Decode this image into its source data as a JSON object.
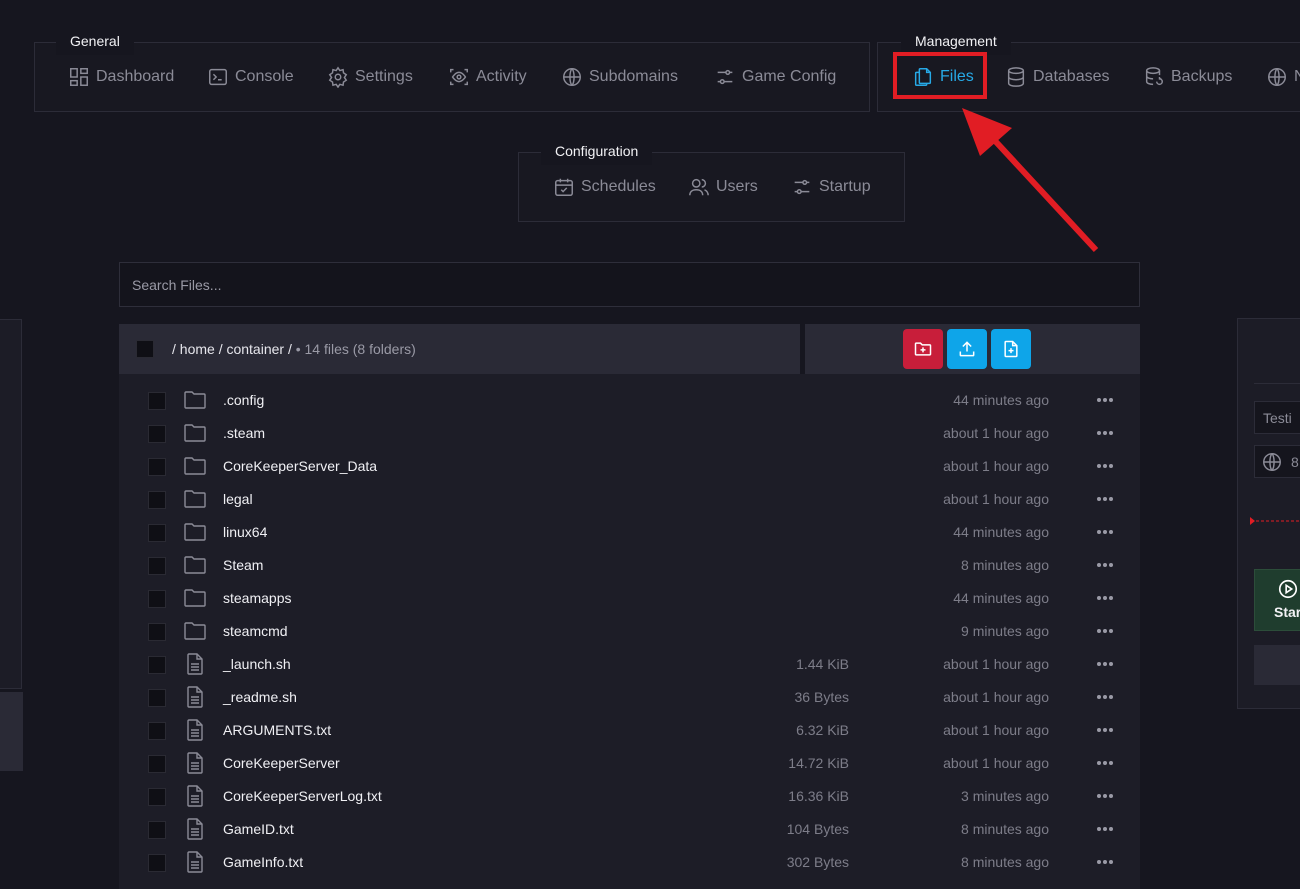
{
  "nav": {
    "general": {
      "label": "General",
      "items": [
        {
          "label": "Dashboard",
          "icon": "dashboard-icon"
        },
        {
          "label": "Console",
          "icon": "console-icon"
        },
        {
          "label": "Settings",
          "icon": "gear-icon"
        },
        {
          "label": "Activity",
          "icon": "eye-icon"
        },
        {
          "label": "Subdomains",
          "icon": "globe-icon"
        },
        {
          "label": "Game Config",
          "icon": "sliders-icon"
        }
      ]
    },
    "management": {
      "label": "Management",
      "items": [
        {
          "label": "Files",
          "icon": "files-icon",
          "active": true
        },
        {
          "label": "Databases",
          "icon": "database-icon"
        },
        {
          "label": "Backups",
          "icon": "backup-icon"
        },
        {
          "label": "N",
          "icon": "globe-icon"
        }
      ]
    },
    "configuration": {
      "label": "Configuration",
      "items": [
        {
          "label": "Schedules",
          "icon": "calendar-icon"
        },
        {
          "label": "Users",
          "icon": "users-icon"
        },
        {
          "label": "Startup",
          "icon": "sliders-icon"
        }
      ]
    }
  },
  "search": {
    "placeholder": "Search Files..."
  },
  "breadcrumb": {
    "path": "/ home / container /",
    "summary": "• 14 files (8 folders)"
  },
  "actions": [
    {
      "name": "new-folder-button",
      "icon": "folder-plus-icon",
      "color": "#c81e3a"
    },
    {
      "name": "upload-button",
      "icon": "upload-icon",
      "color": "#0ea5e9"
    },
    {
      "name": "new-file-button",
      "icon": "file-plus-icon",
      "color": "#0ea5e9"
    }
  ],
  "files": [
    {
      "name": ".config",
      "type": "folder",
      "size": "",
      "modified": "44 minutes ago"
    },
    {
      "name": ".steam",
      "type": "folder",
      "size": "",
      "modified": "about 1 hour ago"
    },
    {
      "name": "CoreKeeperServer_Data",
      "type": "folder",
      "size": "",
      "modified": "about 1 hour ago"
    },
    {
      "name": "legal",
      "type": "folder",
      "size": "",
      "modified": "about 1 hour ago"
    },
    {
      "name": "linux64",
      "type": "folder",
      "size": "",
      "modified": "44 minutes ago"
    },
    {
      "name": "Steam",
      "type": "folder",
      "size": "",
      "modified": "8 minutes ago"
    },
    {
      "name": "steamapps",
      "type": "folder",
      "size": "",
      "modified": "44 minutes ago"
    },
    {
      "name": "steamcmd",
      "type": "folder",
      "size": "",
      "modified": "9 minutes ago"
    },
    {
      "name": "_launch.sh",
      "type": "file",
      "size": "1.44 KiB",
      "modified": "about 1 hour ago"
    },
    {
      "name": "_readme.sh",
      "type": "file",
      "size": "36 Bytes",
      "modified": "about 1 hour ago"
    },
    {
      "name": "ARGUMENTS.txt",
      "type": "file",
      "size": "6.32 KiB",
      "modified": "about 1 hour ago"
    },
    {
      "name": "CoreKeeperServer",
      "type": "file",
      "size": "14.72 KiB",
      "modified": "about 1 hour ago"
    },
    {
      "name": "CoreKeeperServerLog.txt",
      "type": "file",
      "size": "16.36 KiB",
      "modified": "3 minutes ago"
    },
    {
      "name": "GameID.txt",
      "type": "file",
      "size": "104 Bytes",
      "modified": "8 minutes ago"
    },
    {
      "name": "GameInfo.txt",
      "type": "file",
      "size": "302 Bytes",
      "modified": "8 minutes ago"
    }
  ],
  "right_panel": {
    "name_field": "Testi",
    "address_field": "8",
    "start_label": "Star"
  },
  "colors": {
    "accent": "#27a9e6",
    "highlight": "#e11d24",
    "danger": "#c81e3a",
    "primary": "#0ea5e9"
  }
}
